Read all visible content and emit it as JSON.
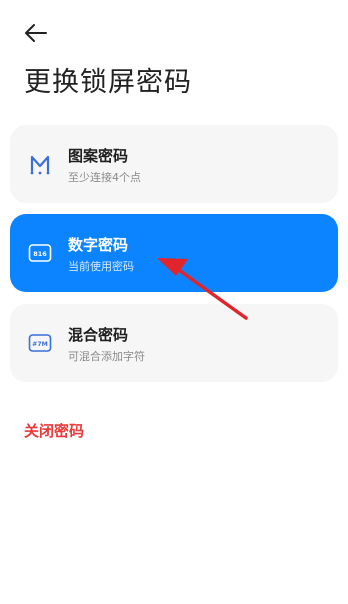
{
  "header": {
    "back_icon": "back-arrow-icon",
    "title": "更换锁屏密码"
  },
  "options": [
    {
      "icon": "pattern-icon",
      "title": "图案密码",
      "subtitle": "至少连接4个点",
      "active": false
    },
    {
      "icon": "numeric-pin-icon",
      "icon_text": "816",
      "title": "数字密码",
      "subtitle": "当前使用密码",
      "active": true
    },
    {
      "icon": "mixed-password-icon",
      "icon_text": "#7M",
      "title": "混合密码",
      "subtitle": "可混合添加字符",
      "active": false
    }
  ],
  "close_password": "关闭密码",
  "colors": {
    "accent": "#0d84ff",
    "danger": "#e83a3a",
    "annotation_arrow": "#e0262c"
  }
}
